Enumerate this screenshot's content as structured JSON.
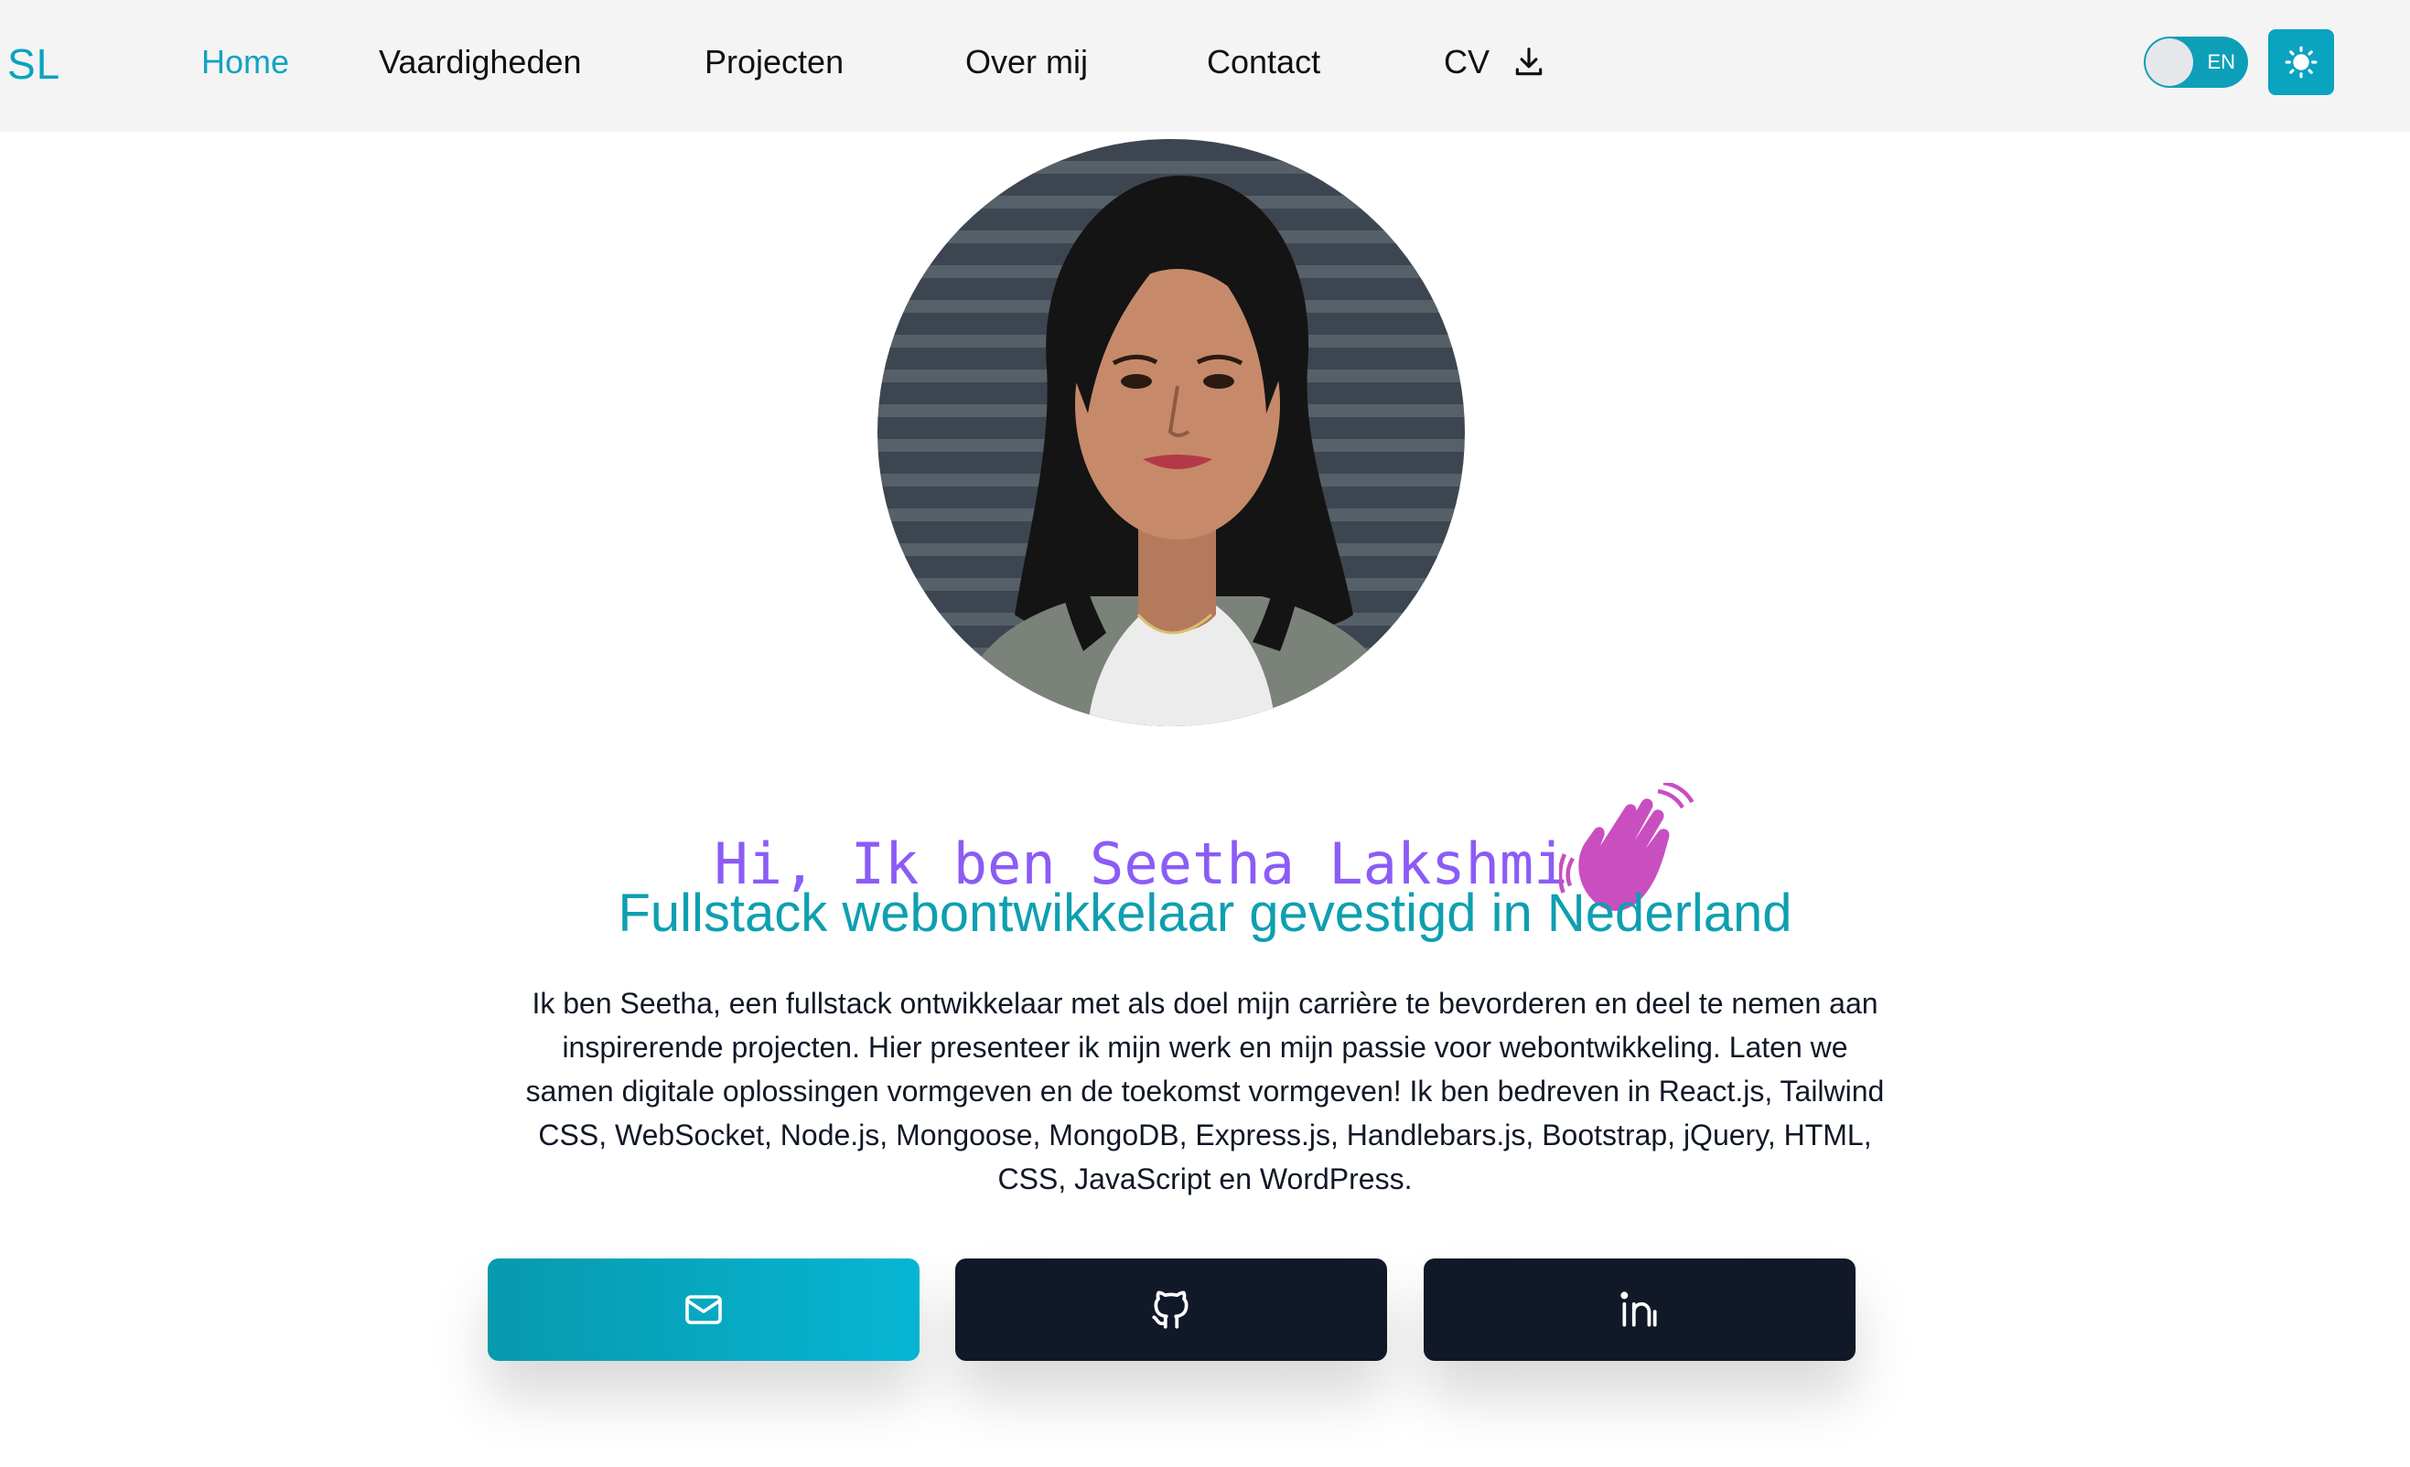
{
  "nav": {
    "logo": "SL",
    "links": [
      "Home",
      "Vaardigheden",
      "Projecten",
      "Over mij",
      "Contact"
    ],
    "cv_label": "CV",
    "active": "Home",
    "language_label": "EN",
    "icons": [
      "download-icon",
      "sun-icon"
    ]
  },
  "hero": {
    "heading": "Hi, Ik ben Seetha Lakshmi",
    "subtitle": "Fullstack webontwikkelaar gevestigd in Nederland",
    "intro": "Ik ben Seetha, een fullstack ontwikkelaar met als doel mijn carrière te bevorderen en deel te nemen aan inspirerende projecten. Hier presenteer ik mijn werk en mijn passie voor webontwikkeling. Laten we samen digitale oplossingen vormgeven en de toekomst vormgeven! Ik ben bedreven in React.js, Tailwind CSS, WebSocket, Node.js, Mongoose, MongoDB, Express.js, Handlebars.js, Bootstrap, jQuery, HTML, CSS, JavaScript en WordPress."
  },
  "buttons": {
    "icons": [
      "mail-icon",
      "github-icon",
      "linkedin-icon"
    ]
  },
  "colors": {
    "accent": "#0aa3c0",
    "heading": "#8b5cf6",
    "subtitle": "#0e9fb0",
    "dark_button": "#111827",
    "wave_hand": "#c94fc0"
  }
}
